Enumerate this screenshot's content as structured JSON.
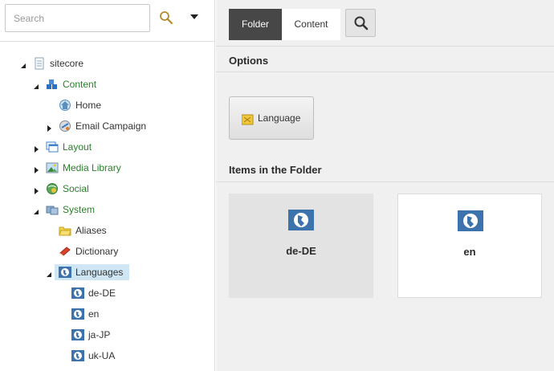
{
  "search": {
    "placeholder": "Search"
  },
  "tree": {
    "root": "sitecore",
    "content": "Content",
    "home": "Home",
    "email_campaign": "Email Campaign",
    "layout": "Layout",
    "media_library": "Media Library",
    "social": "Social",
    "system": "System",
    "aliases": "Aliases",
    "dictionary": "Dictionary",
    "languages": "Languages",
    "lang_items": [
      "de-DE",
      "en",
      "ja-JP",
      "uk-UA"
    ]
  },
  "tabs": {
    "folder": "Folder",
    "content": "Content"
  },
  "options": {
    "title": "Options",
    "language_button": "Language"
  },
  "items_folder": {
    "title": "Items in the Folder",
    "items": [
      "de-DE",
      "en"
    ]
  },
  "colors": {
    "tab_active": "#474747",
    "tree_green": "#2a7f2a",
    "selected": "#cfe6f4",
    "globe": "#3d73ad"
  }
}
